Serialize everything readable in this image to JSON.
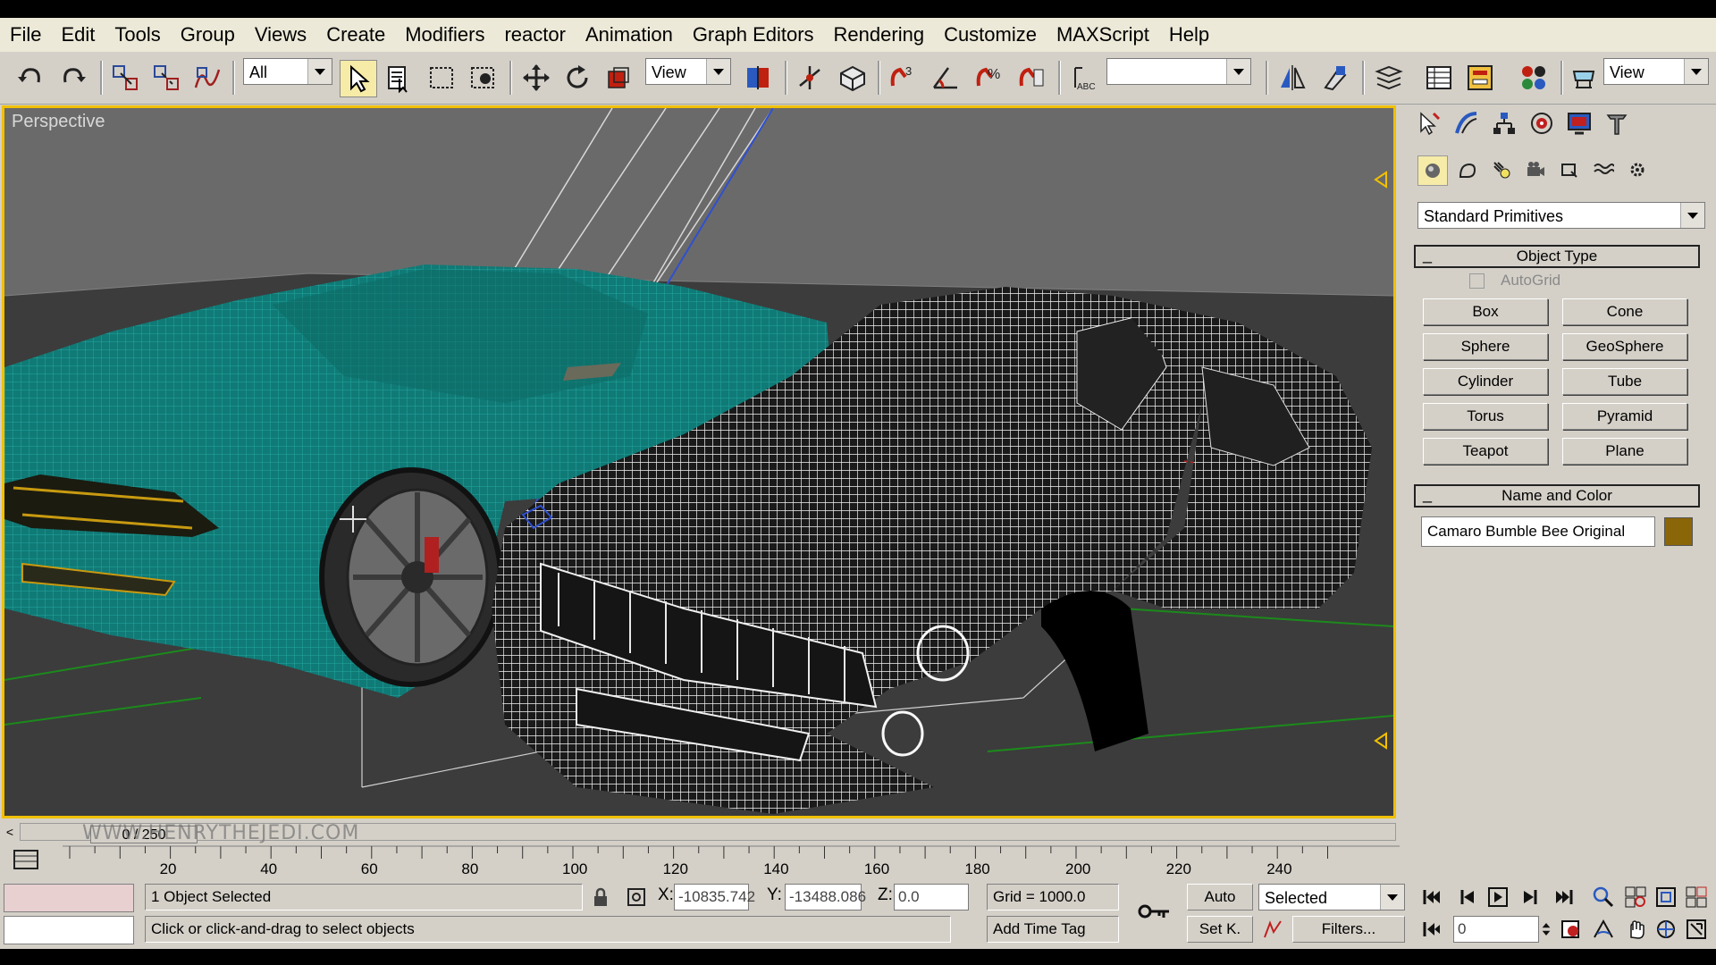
{
  "menu": [
    "File",
    "Edit",
    "Tools",
    "Group",
    "Views",
    "Create",
    "Modifiers",
    "reactor",
    "Animation",
    "Graph Editors",
    "Rendering",
    "Customize",
    "MAXScript",
    "Help"
  ],
  "toolbar": {
    "selection_filter": "All",
    "ref_coord": "View",
    "named_selection": "",
    "render_view": "View"
  },
  "viewport": {
    "label": "Perspective",
    "colors": {
      "background": "#6a6a6a",
      "ground": "#3a3a3a",
      "teal_car": "#0f7f7a",
      "wire_white": "#ffffff",
      "border_active": "#f0c000"
    }
  },
  "command_panel": {
    "category_dropdown": "Standard Primitives",
    "object_type_title": "Object Type",
    "autogrid_label": "AutoGrid",
    "primitives": [
      "Box",
      "Cone",
      "Sphere",
      "GeoSphere",
      "Cylinder",
      "Tube",
      "Torus",
      "Pyramid",
      "Teapot",
      "Plane"
    ],
    "name_color_title": "Name and Color",
    "object_name": "Camaro Bumble Bee Original",
    "object_color": "#8b6608",
    "rollout_collapse_symbol": "_"
  },
  "timeline": {
    "frame_display": "0 / 250",
    "ticks": [
      "20",
      "40",
      "60",
      "80",
      "100",
      "120",
      "140",
      "160",
      "180",
      "200",
      "220",
      "240"
    ]
  },
  "watermark": "WWW.HENRYTHEJEDI.COM",
  "status": {
    "selection": "1 Object Selected",
    "prompt": "Click or click-and-drag to select objects",
    "x_label": "X:",
    "x_value": "-10835.742",
    "y_label": "Y:",
    "y_value": "-13488.086",
    "z_label": "Z:",
    "z_value": "0.0",
    "grid": "Grid = 1000.0",
    "add_time_tag": "Add Time Tag",
    "auto_key": "Auto",
    "set_key": "Set K.",
    "key_filter": "Selected",
    "filters": "Filters...",
    "current_frame": "0"
  }
}
